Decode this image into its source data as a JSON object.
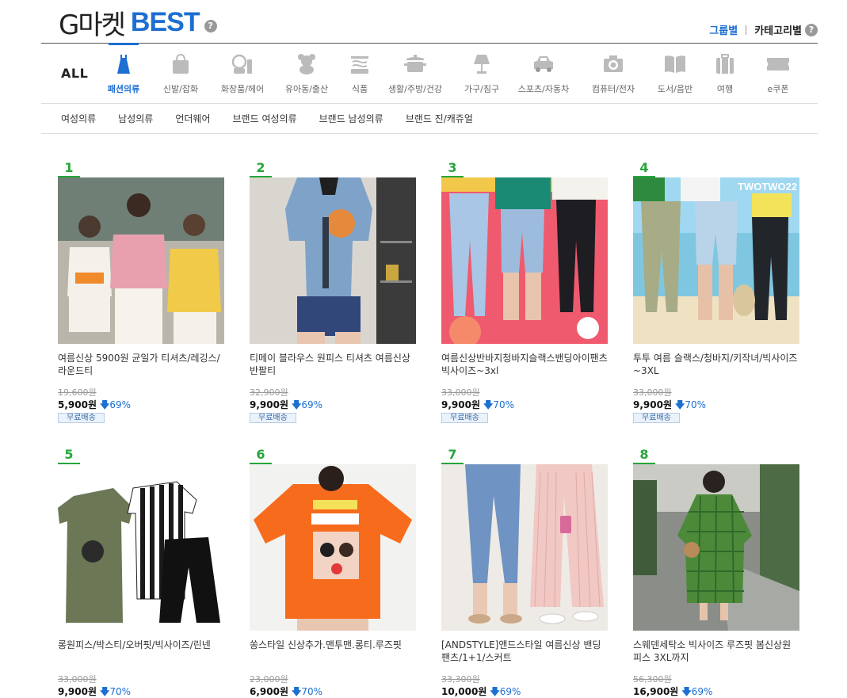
{
  "header": {
    "logo_g": "G마켓",
    "logo_best": "BEST",
    "help": "?",
    "view_group": "그룹별",
    "view_category": "카테고리별"
  },
  "categories": {
    "all": "ALL",
    "items": [
      {
        "label": "패션의류",
        "icon": "dress-icon"
      },
      {
        "label": "신발/잡화",
        "icon": "bag-icon"
      },
      {
        "label": "화장품/헤어",
        "icon": "cosmetics-icon"
      },
      {
        "label": "유아동/출산",
        "icon": "teddy-bear-icon"
      },
      {
        "label": "식품",
        "icon": "food-icon"
      },
      {
        "label": "생활/주방/건강",
        "icon": "pot-icon"
      },
      {
        "label": "가구/침구",
        "icon": "lamp-icon"
      },
      {
        "label": "스포츠/자동차",
        "icon": "car-icon"
      },
      {
        "label": "컴퓨터/전자",
        "icon": "camera-icon"
      },
      {
        "label": "도서/음반",
        "icon": "book-icon"
      },
      {
        "label": "여행",
        "icon": "suitcase-icon"
      },
      {
        "label": "e쿠폰",
        "icon": "ticket-icon"
      }
    ]
  },
  "subcategories": [
    "여성의류",
    "남성의류",
    "언더웨어",
    "브랜드 여성의류",
    "브랜드 남성의류",
    "브랜드 진/캐쥬얼"
  ],
  "colors": {
    "accent": "#1d6fd1",
    "rank": "#26a63b"
  },
  "products": [
    {
      "rank": "1",
      "title": "여름신상 5900원 균일가 티셔츠/레깅스/라운드티",
      "orig": "19,600원",
      "price": "5,900원",
      "discount": "69%",
      "ship": "무료배송"
    },
    {
      "rank": "2",
      "title": "티메이 블라우스 원피스 티셔츠 여름신상 반팔티",
      "orig": "32,900원",
      "price": "9,900원",
      "discount": "69%",
      "ship": "무료배송"
    },
    {
      "rank": "3",
      "title": "여름신상반바지청바지슬랙스밴딩아이팬츠빅사이즈~3xl",
      "orig": "33,000원",
      "price": "9,900원",
      "discount": "70%",
      "ship": "무료배송"
    },
    {
      "rank": "4",
      "title": "투투 여름 슬랙스/청바지/키작녀/빅사이즈~3XL",
      "orig": "33,000원",
      "price": "9,900원",
      "discount": "70%",
      "ship": "무료배송",
      "watermark": "TWOTWO22"
    },
    {
      "rank": "5",
      "title": "롱원피스/박스티/오버핏/빅사이즈/린넨",
      "orig": "33,000원",
      "price": "9,900원",
      "discount": "70%"
    },
    {
      "rank": "6",
      "title": "쏭스타일 신상추가.맨투맨.롱티.루즈핏",
      "orig": "23,000원",
      "price": "6,900원",
      "discount": "70%"
    },
    {
      "rank": "7",
      "title": "[ANDSTYLE]앤드스타일 여름신상 밴딩팬츠/1+1/스커트",
      "orig": "33,300원",
      "price": "10,000원",
      "discount": "69%"
    },
    {
      "rank": "8",
      "title": "스웨덴세탁소 빅사이즈 루즈핏 봄신상원피스 3XL까지",
      "orig": "56,300원",
      "price": "16,900원",
      "discount": "69%"
    }
  ]
}
